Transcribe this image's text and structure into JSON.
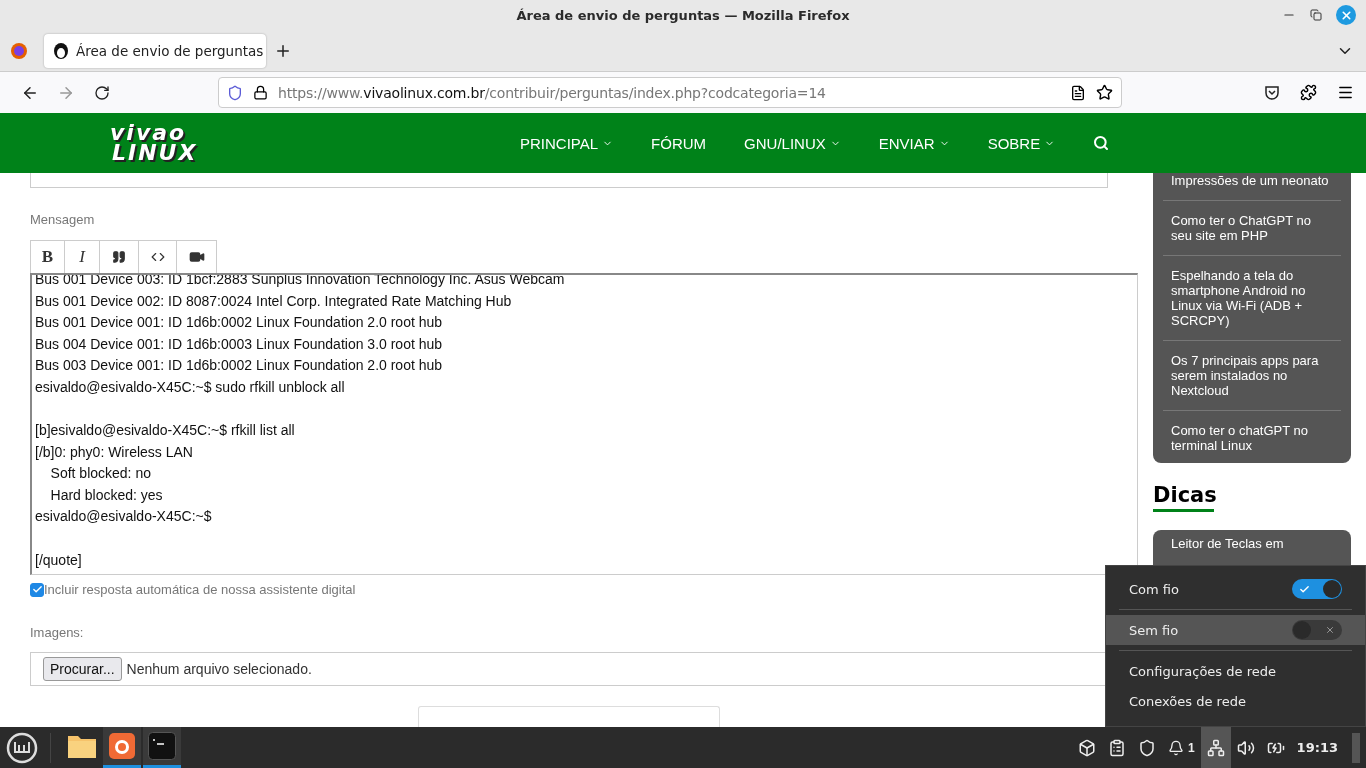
{
  "window": {
    "title": "Área de envio de perguntas — Mozilla Firefox"
  },
  "tabs": [
    {
      "label": "Área de envio de perguntas",
      "selected": true
    }
  ],
  "address_bar": {
    "url_prefix": "https://www.",
    "url_domain": "vivaolinux.com.br",
    "url_path": "/contribuir/perguntas/index.php?codcategoria=14"
  },
  "site_header": {
    "logo": [
      "vivao",
      "LINUX"
    ],
    "menu": [
      {
        "label": "PRINCIPAL",
        "has_dropdown": true
      },
      {
        "label": "FÓRUM",
        "has_dropdown": false
      },
      {
        "label": "GNU/LINUX",
        "has_dropdown": true
      },
      {
        "label": "ENVIAR",
        "has_dropdown": true
      },
      {
        "label": "SOBRE",
        "has_dropdown": true
      }
    ]
  },
  "form": {
    "message_label": "Mensagem",
    "toolbar": [
      {
        "kind": "text",
        "label": "B"
      },
      {
        "kind": "text",
        "label": "I"
      },
      {
        "kind": "quote"
      },
      {
        "kind": "code"
      },
      {
        "kind": "video"
      }
    ],
    "message_blocks": [
      [
        "Bus 001 Device 003: ID 1bcf:2883 Sunplus Innovation Technology Inc. Asus Webcam",
        "Bus 001 Device 002: ID 8087:0024 Intel Corp. Integrated Rate Matching Hub",
        "Bus 001 Device 001: ID 1d6b:0002 Linux Foundation 2.0 root hub",
        "Bus 004 Device 001: ID 1d6b:0003 Linux Foundation 3.0 root hub",
        "Bus 003 Device 001: ID 1d6b:0002 Linux Foundation 2.0 root hub",
        "esivaldo@esivaldo-X45C:~$ sudo rfkill unblock all"
      ],
      [
        "[b]esivaldo@esivaldo-X45C:~$ rfkill list all",
        "[/b]0: phy0: Wireless LAN",
        "\tSoft blocked: no",
        "\tHard blocked: yes",
        "esivaldo@esivaldo-X45C:~$"
      ],
      [
        "[/quote]"
      ]
    ],
    "auto_reply": {
      "label": "Incluir resposta automática de nossa assistente digital",
      "checked": true
    },
    "images_label": "Imagens:",
    "file_button": "Procurar...",
    "file_status": "Nenhum arquivo selecionado."
  },
  "sidebar": {
    "articles": [
      "Impressões de um neonato",
      "Como ter o ChatGPT no seu site em PHP",
      "Espelhando a tela do smartphone Android no Linux via Wi-Fi (ADB + SCRCPY)",
      "Os 7 principais apps para serem instalados no Nextcloud",
      "Como ter o chatGPT no terminal Linux"
    ],
    "tips_heading": "Dicas",
    "tips": [
      "Leitor de Teclas em"
    ]
  },
  "network_menu": {
    "items": [
      {
        "kind": "toggle",
        "label": "Com fio",
        "on": true,
        "selected": false
      },
      {
        "kind": "toggle",
        "label": "Sem fio",
        "on": false,
        "selected": true
      },
      {
        "kind": "link",
        "label": "Configurações de rede",
        "selected": false
      },
      {
        "kind": "link",
        "label": "Conexões de rede",
        "selected": false
      }
    ]
  },
  "taskbar": {
    "apps": [
      {
        "kind": "files",
        "active": false
      },
      {
        "kind": "firefox",
        "active": true
      },
      {
        "kind": "terminal",
        "active": true
      }
    ],
    "tray": [
      {
        "kind": "dropbox",
        "selected": false
      },
      {
        "kind": "clipboard",
        "selected": false
      },
      {
        "kind": "shield",
        "selected": false
      },
      {
        "kind": "bell",
        "count": "1",
        "selected": false
      },
      {
        "kind": "network",
        "selected": true
      },
      {
        "kind": "volume",
        "selected": false
      },
      {
        "kind": "battery",
        "selected": false
      }
    ],
    "clock": "19:13"
  }
}
